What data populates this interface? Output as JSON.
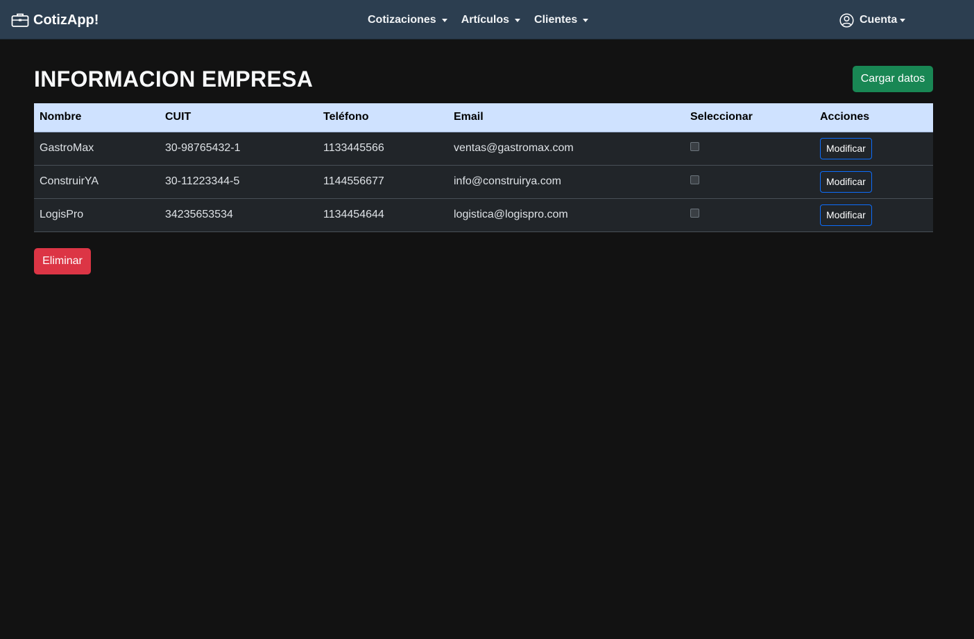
{
  "navbar": {
    "brand": "CotizApp!",
    "brand_icon": "briefcase-icon",
    "menu": [
      {
        "label": "Cotizaciones"
      },
      {
        "label": "Artículos"
      },
      {
        "label": "Clientes"
      }
    ],
    "account": {
      "label": "Cuenta",
      "icon": "user-circle-icon"
    }
  },
  "page": {
    "title": "INFORMACION EMPRESA",
    "load_button": "Cargar datos",
    "delete_button": "Eliminar"
  },
  "table": {
    "headers": [
      "Nombre",
      "CUIT",
      "Teléfono",
      "Email",
      "Seleccionar",
      "Acciones"
    ],
    "rows": [
      {
        "nombre": "GastroMax",
        "cuit": "30-98765432-1",
        "telefono": "1133445566",
        "email": "ventas@gastromax.com",
        "selected": false,
        "action": "Modificar"
      },
      {
        "nombre": "ConstruirYA",
        "cuit": "30-11223344-5",
        "telefono": "1144556677",
        "email": "info@construirya.com",
        "selected": false,
        "action": "Modificar"
      },
      {
        "nombre": "LogisPro",
        "cuit": "34235653534",
        "telefono": "1134454644",
        "email": "logistica@logispro.com",
        "selected": false,
        "action": "Modificar"
      }
    ]
  },
  "colors": {
    "navbar_bg": "#2c3e50",
    "page_bg": "#121212",
    "table_header_bg": "#cfe2ff",
    "row_bg": "#212529",
    "success": "#198754",
    "danger": "#dc3545",
    "primary_outline": "#0d6efd"
  }
}
